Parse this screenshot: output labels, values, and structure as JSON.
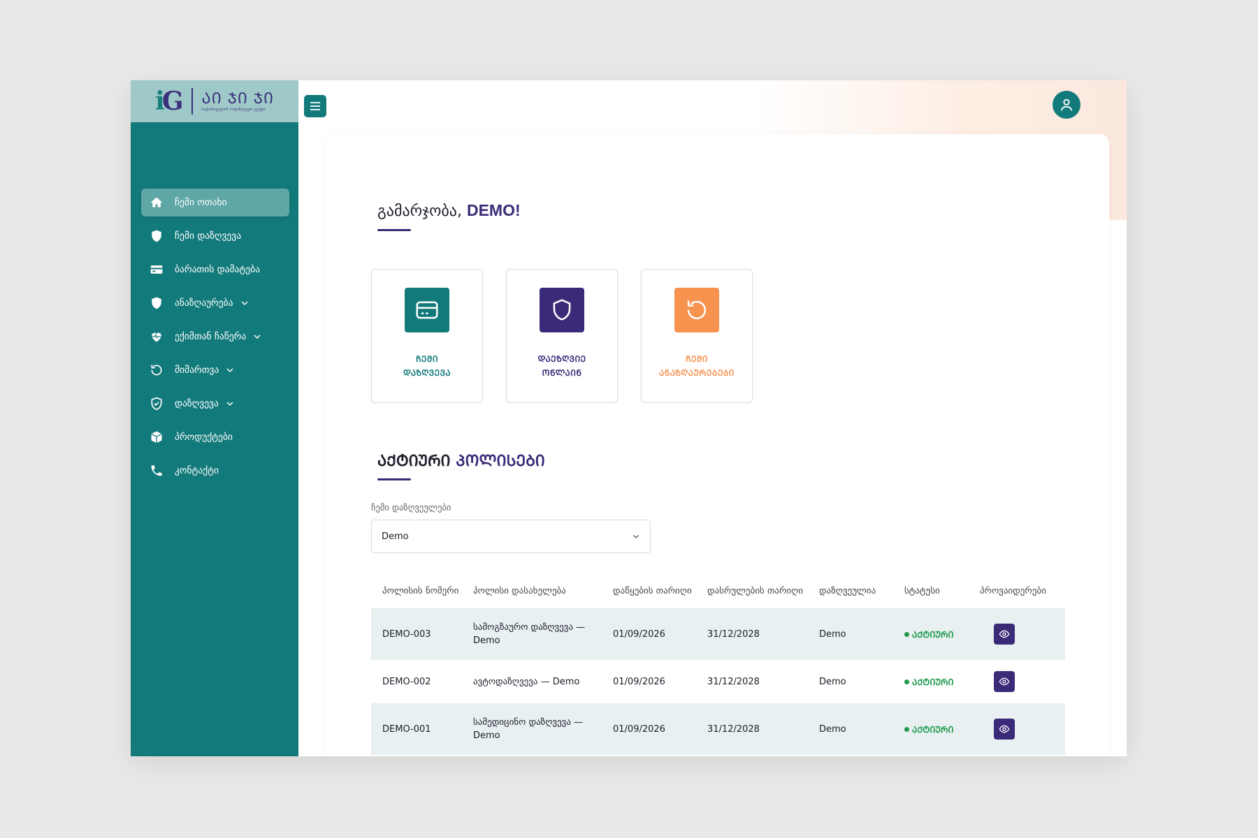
{
  "logo": {
    "text": "ᲐᲘ ᲯᲘ ᲯᲘ",
    "subtext": "საქართველოს სადაზღვევო ჯგუფი"
  },
  "sidebar": {
    "items": [
      {
        "label": "ჩემი ოთახი",
        "icon": "home-icon",
        "active": true,
        "chevron": false
      },
      {
        "label": "ჩემი დაზღვევა",
        "icon": "shield-icon",
        "active": false,
        "chevron": false
      },
      {
        "label": "ბარათის დამატება",
        "icon": "card-icon",
        "active": false,
        "chevron": false
      },
      {
        "label": "ანაზღაურება",
        "icon": "shield-icon",
        "active": false,
        "chevron": true
      },
      {
        "label": "ექიმთან ჩაწერა",
        "icon": "heart-pulse-icon",
        "active": false,
        "chevron": true
      },
      {
        "label": "მიმართვა",
        "icon": "refresh-icon",
        "active": false,
        "chevron": true
      },
      {
        "label": "დაზღვევა",
        "icon": "shield-check-icon",
        "active": false,
        "chevron": true
      },
      {
        "label": "პროდუქტები",
        "icon": "box-icon",
        "active": false,
        "chevron": false
      },
      {
        "label": "კონტაქტი",
        "icon": "phone-icon",
        "active": false,
        "chevron": false
      }
    ]
  },
  "greeting": {
    "prefix": "გამარჯობა, ",
    "name": "DEMO!"
  },
  "quick_actions": [
    {
      "line1": "ᲩᲔᲛᲘ",
      "line2": "ᲓᲐᲖᲦᲕᲔᲕᲐ",
      "icon": "card-icon",
      "color": "#137a7b",
      "text_color": "#137a7b"
    },
    {
      "line1": "ᲓᲐᲔᲖᲦᲕᲘᲔ",
      "line2": "ᲝᲜᲚᲐᲘᲜ",
      "icon": "shield-icon",
      "color": "#3b2a78",
      "text_color": "#3b2a78"
    },
    {
      "line1": "ᲩᲔᲛᲘ",
      "line2": "ᲐᲜᲐᲖᲦᲐᲣᲠᲔᲑᲔᲑᲘ",
      "icon": "refresh-icon",
      "color": "#f7924f",
      "text_color": "#f7924f"
    }
  ],
  "policies": {
    "title_part1": "ᲐᲥᲢᲘᲣᲠᲘ ",
    "title_part2": "ᲞᲝᲚᲘᲡᲔᲑᲘ",
    "field_label": "ჩემი დაზღვეულები",
    "selected": "Demo",
    "columns": [
      "პოლისის ნომერი",
      "პოლისი დასახელება",
      "დაწყების თარიღი",
      "დასრულების თარიღი",
      "დაზღვეულია",
      "სტატუსი",
      "პროვაიდერები"
    ],
    "rows": [
      {
        "number": "DEMO-003",
        "name": "სამოგზაურო დაზღვევა — Demo",
        "start": "01/09/2026",
        "end": "31/12/2028",
        "insured": "Demo",
        "status": "ᲐᲥᲢᲘᲣᲠᲘ"
      },
      {
        "number": "DEMO-002",
        "name": "ავტოდაზღვევა — Demo",
        "start": "01/09/2026",
        "end": "31/12/2028",
        "insured": "Demo",
        "status": "ᲐᲥᲢᲘᲣᲠᲘ"
      },
      {
        "number": "DEMO-001",
        "name": "სამედიცინო დაზღვევა — Demo",
        "start": "01/09/2026",
        "end": "31/12/2028",
        "insured": "Demo",
        "status": "ᲐᲥᲢᲘᲣᲠᲘ"
      }
    ]
  },
  "colors": {
    "teal": "#137a7b",
    "purple": "#3b2a78",
    "orange": "#f7924f",
    "active_green": "#1f9a4d"
  }
}
